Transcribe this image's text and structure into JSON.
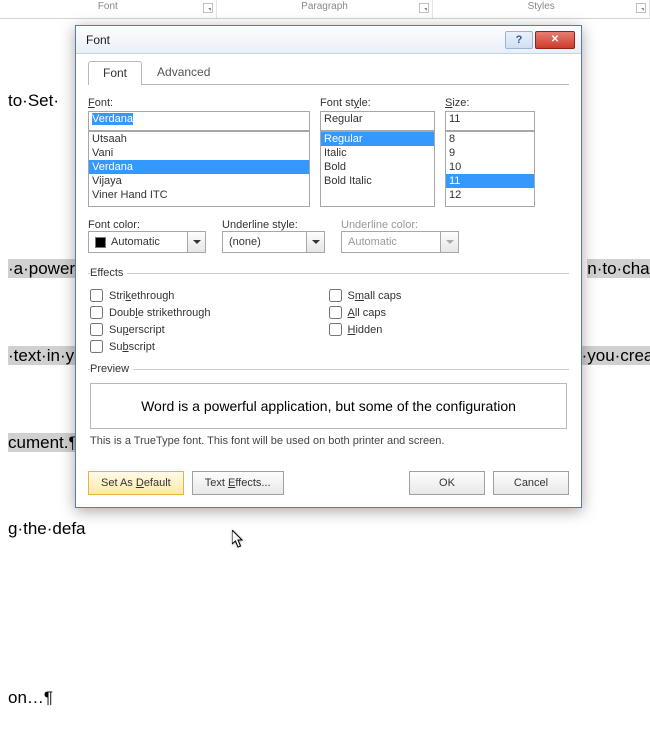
{
  "ribbon": {
    "groups": [
      "Font",
      "Paragraph",
      "Styles"
    ]
  },
  "background_doc": {
    "line1": "to·Set·",
    "line2_pre": "·a·powerfu",
    "line2_post": "n·to·change·",
    "line3_pre": "·text·in·yo",
    "line3_post": "·you·create·",
    "line4": "cument.¶",
    "line5": "g·the·defa",
    "line6": "on…¶"
  },
  "dialog": {
    "title": "Font",
    "tabs": {
      "font": "Font",
      "advanced": "Advanced"
    },
    "font_section": {
      "label": "Font:",
      "value": "Verdana",
      "options": [
        "Utsaah",
        "Vani",
        "Verdana",
        "Vijaya",
        "Viner Hand ITC"
      ],
      "selected_index": 2
    },
    "style_section": {
      "label": "Font style:",
      "value": "Regular",
      "options": [
        "Regular",
        "Italic",
        "Bold",
        "Bold Italic"
      ],
      "selected_index": 0
    },
    "size_section": {
      "label": "Size:",
      "value": "11",
      "options": [
        "8",
        "9",
        "10",
        "11",
        "12"
      ],
      "selected_index": 3
    },
    "font_color": {
      "label": "Font color:",
      "value": "Automatic"
    },
    "underline_style": {
      "label": "Underline style:",
      "value": "(none)"
    },
    "underline_color": {
      "label": "Underline color:",
      "value": "Automatic"
    },
    "effects": {
      "legend": "Effects",
      "left": [
        "Strikethrough",
        "Double strikethrough",
        "Superscript",
        "Subscript"
      ],
      "right": [
        "Small caps",
        "All caps",
        "Hidden"
      ]
    },
    "preview": {
      "legend": "Preview",
      "text": "Word is a powerful application, but some of the configuration",
      "note": "This is a TrueType font. This font will be used on both printer and screen."
    },
    "buttons": {
      "default": "Set As Default",
      "text_effects": "Text Effects...",
      "ok": "OK",
      "cancel": "Cancel"
    }
  }
}
